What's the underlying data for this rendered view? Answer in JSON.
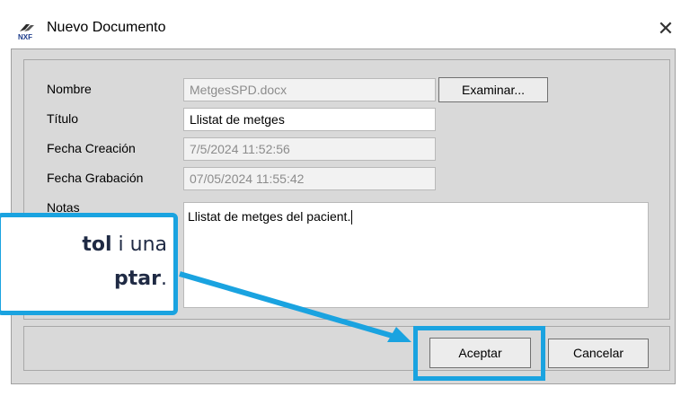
{
  "window": {
    "title": "Nuevo Documento",
    "app_icon_text": "NXF",
    "close_symbol": "✕"
  },
  "form": {
    "labels": {
      "nombre": "Nombre",
      "titulo": "Título",
      "fecha_creacion": "Fecha Creación",
      "fecha_grabacion": "Fecha Grabación",
      "notas": "Notas"
    },
    "values": {
      "nombre": "MetgesSPD.docx",
      "titulo": "Llistat de metges",
      "fecha_creacion": "7/5/2024 11:52:56",
      "fecha_grabacion": "07/05/2024 11:55:42",
      "notas": "Llistat de metges del pacient."
    },
    "browse_label": "Examinar..."
  },
  "buttons": {
    "accept": "Aceptar",
    "cancel": "Cancelar"
  },
  "callout": {
    "line1_bold": "tol",
    "line1_rest": " i una",
    "line2_bold": "ptar",
    "line2_rest": "."
  },
  "colors": {
    "accent": "#1aa3e0",
    "dialog_bg": "#d9d9d9",
    "callout_text": "#1f2a44"
  },
  "icons": [
    "nxf-app-icon",
    "close-icon",
    "callout-arrow-icon"
  ]
}
